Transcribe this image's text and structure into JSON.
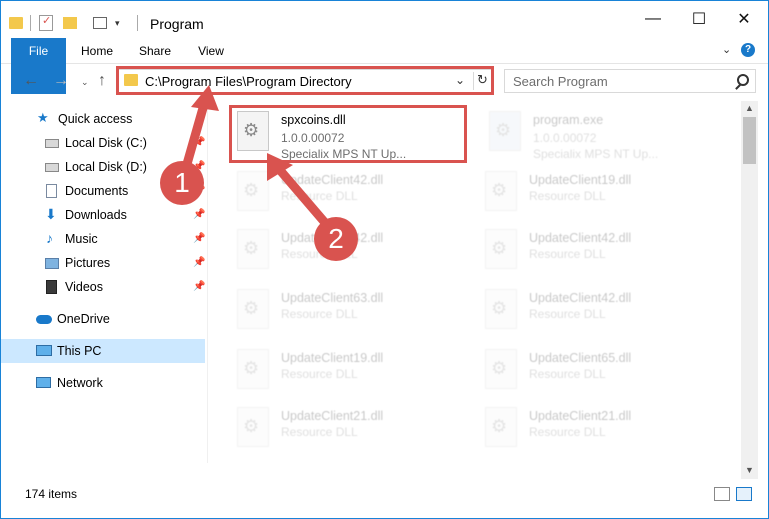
{
  "window": {
    "title": "Program",
    "controls": {
      "minimize": "—",
      "maximize": "☐",
      "close": "✕"
    }
  },
  "ribbon": {
    "tabs": [
      "File",
      "Home",
      "Share",
      "View"
    ],
    "help_icon": "help-icon"
  },
  "nav": {
    "address": "C:\\Program Files\\Program Directory",
    "search_placeholder": "Search Program"
  },
  "sidebar": {
    "items": [
      {
        "label": "Quick access",
        "icon": "star-icon",
        "pinned": false
      },
      {
        "label": "Local Disk (C:)",
        "icon": "drive-icon",
        "pinned": true
      },
      {
        "label": "Local Disk (D:)",
        "icon": "drive-icon",
        "pinned": true
      },
      {
        "label": "Documents",
        "icon": "documents-icon",
        "pinned": true
      },
      {
        "label": "Downloads",
        "icon": "download-icon",
        "pinned": true
      },
      {
        "label": "Music",
        "icon": "music-icon",
        "pinned": true
      },
      {
        "label": "Pictures",
        "icon": "pictures-icon",
        "pinned": true
      },
      {
        "label": "Videos",
        "icon": "videos-icon",
        "pinned": true
      },
      {
        "label": "OneDrive",
        "icon": "cloud-icon",
        "pinned": false
      },
      {
        "label": "This PC",
        "icon": "computer-icon",
        "pinned": false,
        "selected": true
      },
      {
        "label": "Network",
        "icon": "network-icon",
        "pinned": false
      }
    ]
  },
  "files": [
    {
      "name": "spxcoins.dll",
      "line2": "1.0.0.00072",
      "line3": "Specialix MPS NT Up..."
    },
    {
      "name": "program.exe",
      "line2": "1.0.0.00072",
      "line3": "Specialix MPS NT Up..."
    },
    {
      "name": "UpdateClient42.dll",
      "line2": "Resource DLL"
    },
    {
      "name": "UpdateClient19.dll",
      "line2": "Resource DLL"
    },
    {
      "name": "UpdateClient42.dll",
      "line2": "Resource DLL"
    },
    {
      "name": "UpdateClient42.dll",
      "line2": "Resource DLL"
    },
    {
      "name": "UpdateClient63.dll",
      "line2": "Resource DLL"
    },
    {
      "name": "UpdateClient42.dll",
      "line2": "Resource DLL"
    },
    {
      "name": "UpdateClient19.dll",
      "line2": "Resource DLL"
    },
    {
      "name": "UpdateClient65.dll",
      "line2": "Resource DLL"
    },
    {
      "name": "UpdateClient21.dll",
      "line2": "Resource DLL"
    },
    {
      "name": "UpdateClient21.dll",
      "line2": "Resource DLL"
    }
  ],
  "status": {
    "item_count": "174 items"
  },
  "callouts": [
    "1",
    "2"
  ],
  "colors": {
    "accent": "#1979ca",
    "highlight": "#d9534f",
    "selected": "#cce8ff"
  }
}
